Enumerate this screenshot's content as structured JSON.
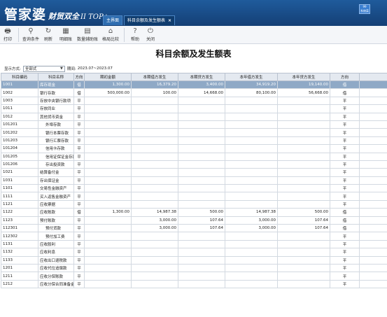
{
  "app": {
    "logo_main": "管家婆",
    "logo_sub": "财贸双全",
    "logo_ver": "II TOP+",
    "tabs": [
      {
        "label": "主界面",
        "closable": false
      },
      {
        "label": "科目余额及发生额表",
        "closable": true
      }
    ],
    "close_glyph": "×",
    "corner_text": [
      "99",
      "系统菜"
    ]
  },
  "toolbar": [
    {
      "label": "打印",
      "icon": "printer-icon",
      "glyph": "🖶",
      "dropdown": true
    },
    {
      "label": "查询条件",
      "icon": "search-icon",
      "glyph": "⚲"
    },
    {
      "label": "刷新",
      "icon": "refresh-icon",
      "glyph": "↻"
    },
    {
      "label": "明细账",
      "icon": "ledger-icon",
      "glyph": "▦"
    },
    {
      "label": "数量辅助账",
      "icon": "subledger-icon",
      "glyph": "▤",
      "dropdown": true
    },
    {
      "label": "格局比较",
      "icon": "home-icon",
      "glyph": "⌂"
    },
    {
      "label": "帮助",
      "icon": "help-icon",
      "glyph": "?"
    },
    {
      "label": "关闭",
      "icon": "power-icon",
      "glyph": "⏻"
    }
  ],
  "report_title": "科目余额及发生额表",
  "filters": {
    "display_label": "显示方式:",
    "display_value": "全部式",
    "period_label": "期间:",
    "period_value": "2023.07~2023.07"
  },
  "columns": [
    "科目编码",
    "科目名称",
    "方向",
    "期初金额",
    "本期借方发生",
    "本期贷方发生",
    "本年借方发生",
    "本年贷方发生",
    "方向"
  ],
  "rows": [
    {
      "code": "1001",
      "name": "库存现金",
      "dir": "借",
      "open": "1,300.00",
      "pd": "16,379.20",
      "pc": "3,400.00",
      "yd": "34,919.20",
      "yc": "19,140.00",
      "edir": "借",
      "selected": true
    },
    {
      "code": "1002",
      "name": "银行存款",
      "dir": "借",
      "open": "500,000.00",
      "pd": "100.00",
      "pc": "14,668.00",
      "yd": "80,100.00",
      "yc": "56,668.00",
      "edir": "借"
    },
    {
      "code": "1003",
      "name": "存放中央银行款项",
      "dir": "平",
      "open": "",
      "pd": "",
      "pc": "",
      "yd": "",
      "yc": "",
      "edir": "平"
    },
    {
      "code": "1011",
      "name": "存放同业",
      "dir": "平",
      "open": "",
      "pd": "",
      "pc": "",
      "yd": "",
      "yc": "",
      "edir": "平"
    },
    {
      "code": "1012",
      "name": "其他货币资金",
      "dir": "平",
      "open": "",
      "pd": "",
      "pc": "",
      "yd": "",
      "yc": "",
      "edir": "平"
    },
    {
      "code": "101201",
      "name": "外埠存款",
      "dir": "平",
      "open": "",
      "pd": "",
      "pc": "",
      "yd": "",
      "yc": "",
      "edir": "平",
      "indent": true
    },
    {
      "code": "101202",
      "name": "银行本票存款",
      "dir": "平",
      "open": "",
      "pd": "",
      "pc": "",
      "yd": "",
      "yc": "",
      "edir": "平",
      "indent": true
    },
    {
      "code": "101203",
      "name": "银行汇票存款",
      "dir": "平",
      "open": "",
      "pd": "",
      "pc": "",
      "yd": "",
      "yc": "",
      "edir": "平",
      "indent": true
    },
    {
      "code": "101204",
      "name": "信用卡存款",
      "dir": "平",
      "open": "",
      "pd": "",
      "pc": "",
      "yd": "",
      "yc": "",
      "edir": "平",
      "indent": true
    },
    {
      "code": "101205",
      "name": "信用证保证金存款",
      "dir": "平",
      "open": "",
      "pd": "",
      "pc": "",
      "yd": "",
      "yc": "",
      "edir": "平",
      "indent": true
    },
    {
      "code": "101206",
      "name": "存出投资款",
      "dir": "平",
      "open": "",
      "pd": "",
      "pc": "",
      "yd": "",
      "yc": "",
      "edir": "平",
      "indent": true
    },
    {
      "code": "1021",
      "name": "结算备付金",
      "dir": "平",
      "open": "",
      "pd": "",
      "pc": "",
      "yd": "",
      "yc": "",
      "edir": "平"
    },
    {
      "code": "1031",
      "name": "存出保证金",
      "dir": "平",
      "open": "",
      "pd": "",
      "pc": "",
      "yd": "",
      "yc": "",
      "edir": "平"
    },
    {
      "code": "1101",
      "name": "交易性金融资产",
      "dir": "平",
      "open": "",
      "pd": "",
      "pc": "",
      "yd": "",
      "yc": "",
      "edir": "平"
    },
    {
      "code": "1111",
      "name": "买入返售金融资产",
      "dir": "平",
      "open": "",
      "pd": "",
      "pc": "",
      "yd": "",
      "yc": "",
      "edir": "平"
    },
    {
      "code": "1121",
      "name": "应收票据",
      "dir": "平",
      "open": "",
      "pd": "",
      "pc": "",
      "yd": "",
      "yc": "",
      "edir": "平"
    },
    {
      "code": "1122",
      "name": "应收账款",
      "dir": "借",
      "open": "1,300.00",
      "pd": "14,987.38",
      "pc": "500.00",
      "yd": "14,987.38",
      "yc": "500.00",
      "edir": "借"
    },
    {
      "code": "1123",
      "name": "预付账款",
      "dir": "平",
      "open": "",
      "pd": "3,000.00",
      "pc": "107.64",
      "yd": "3,000.00",
      "yc": "107.64",
      "edir": "借"
    },
    {
      "code": "112301",
      "name": "预付货款",
      "dir": "平",
      "open": "",
      "pd": "3,000.00",
      "pc": "107.64",
      "yd": "3,000.00",
      "yc": "107.64",
      "edir": "借",
      "indent": true
    },
    {
      "code": "112302",
      "name": "预付加工费",
      "dir": "平",
      "open": "",
      "pd": "",
      "pc": "",
      "yd": "",
      "yc": "",
      "edir": "平",
      "indent": true
    },
    {
      "code": "1131",
      "name": "应收股利",
      "dir": "平",
      "open": "",
      "pd": "",
      "pc": "",
      "yd": "",
      "yc": "",
      "edir": "平"
    },
    {
      "code": "1132",
      "name": "应收利息",
      "dir": "平",
      "open": "",
      "pd": "",
      "pc": "",
      "yd": "",
      "yc": "",
      "edir": "平"
    },
    {
      "code": "1133",
      "name": "应收出口退税款",
      "dir": "平",
      "open": "",
      "pd": "",
      "pc": "",
      "yd": "",
      "yc": "",
      "edir": "平"
    },
    {
      "code": "1201",
      "name": "应收代位追偿款",
      "dir": "平",
      "open": "",
      "pd": "",
      "pc": "",
      "yd": "",
      "yc": "",
      "edir": "平"
    },
    {
      "code": "1211",
      "name": "应收分保账款",
      "dir": "平",
      "open": "",
      "pd": "",
      "pc": "",
      "yd": "",
      "yc": "",
      "edir": "平"
    },
    {
      "code": "1212",
      "name": "应收分保合同准备金",
      "dir": "平",
      "open": "",
      "pd": "",
      "pc": "",
      "yd": "",
      "yc": "",
      "edir": "平"
    }
  ],
  "colors": {
    "header_bg": "#1a4d89",
    "selected_row": "#8fa9c6",
    "grid_header": "#e4e9f0"
  }
}
